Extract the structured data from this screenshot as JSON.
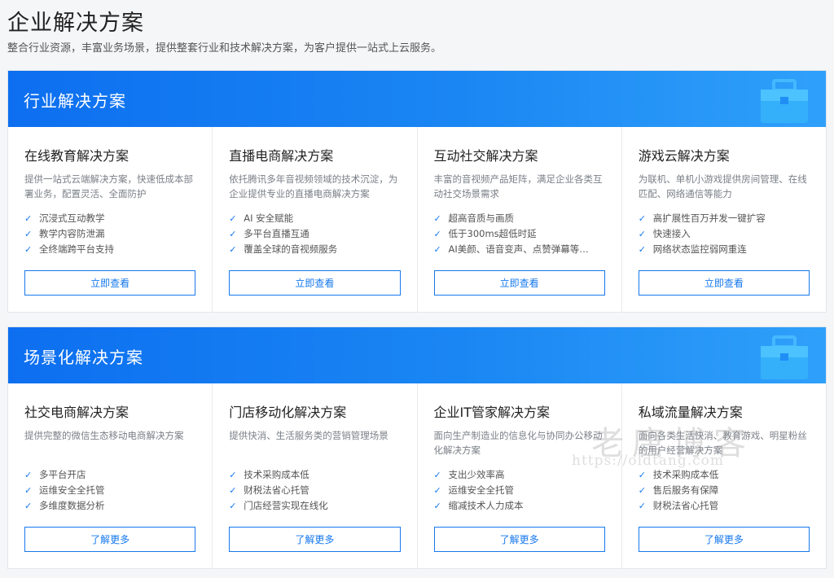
{
  "page": {
    "title": "企业解决方案",
    "subtitle": "整合行业资源，丰富业务场景，提供整套行业和技术解决方案，为客户提供一站式上云服务。"
  },
  "sections": [
    {
      "title": "行业解决方案",
      "cards": [
        {
          "title": "在线教育解决方案",
          "desc": "提供一站式云端解决方案，快速低成本部署业务，配置灵活、全面防护",
          "features": [
            "沉浸式互动教学",
            "教学内容防泄漏",
            "全终端跨平台支持"
          ],
          "button": "立即查看"
        },
        {
          "title": "直播电商解决方案",
          "desc": "依托腾讯多年音视频领域的技术沉淀，为企业提供专业的直播电商解决方案",
          "features": [
            "AI 安全赋能",
            "多平台直播互通",
            "覆盖全球的音视频服务"
          ],
          "button": "立即查看"
        },
        {
          "title": "互动社交解决方案",
          "desc": "丰富的音视频产品矩阵，满足企业各类互动社交场景需求",
          "features": [
            "超高音质与画质",
            "低于300ms超低时延",
            "AI美颜、语音变声、点赞弹幕等…"
          ],
          "button": "立即查看"
        },
        {
          "title": "游戏云解决方案",
          "desc": "为联机、单机小游戏提供房间管理、在线匹配、网络通信等能力",
          "features": [
            "高扩展性百万并发一键扩容",
            "快速接入",
            "网络状态监控弱网重连"
          ],
          "button": "立即查看"
        }
      ]
    },
    {
      "title": "场景化解决方案",
      "cards": [
        {
          "title": "社交电商解决方案",
          "desc": "提供完整的微信生态移动电商解决方案",
          "features": [
            "多平台开店",
            "运维安全全托管",
            "多维度数据分析"
          ],
          "button": "了解更多"
        },
        {
          "title": "门店移动化解决方案",
          "desc": "提供快消、生活服务类的营销管理场景",
          "features": [
            "技术采购成本低",
            "财税法省心托管",
            "门店经营实现在线化"
          ],
          "button": "了解更多"
        },
        {
          "title": "企业IT管家解决方案",
          "desc": "面向生产制造业的信息化与协同办公移动化解决方案",
          "features": [
            "支出少效率高",
            "运维安全全托管",
            "缩减技术人力成本"
          ],
          "button": "了解更多"
        },
        {
          "title": "私域流量解决方案",
          "desc": "面向各类生活快消、教育游戏、明星粉丝的用户经营解决方案",
          "features": [
            "技术采购成本低",
            "售后服务有保障",
            "财税法省心托管"
          ],
          "button": "了解更多"
        }
      ]
    }
  ],
  "watermark": {
    "text": "老唐博客",
    "url": "https://oldtang.com"
  },
  "icons": {
    "check": "check-icon",
    "banner": "briefcase-icon"
  },
  "colors": {
    "accent": "#1678ee",
    "banner_start": "#0d6ff0",
    "banner_end": "#2fa0fa"
  }
}
